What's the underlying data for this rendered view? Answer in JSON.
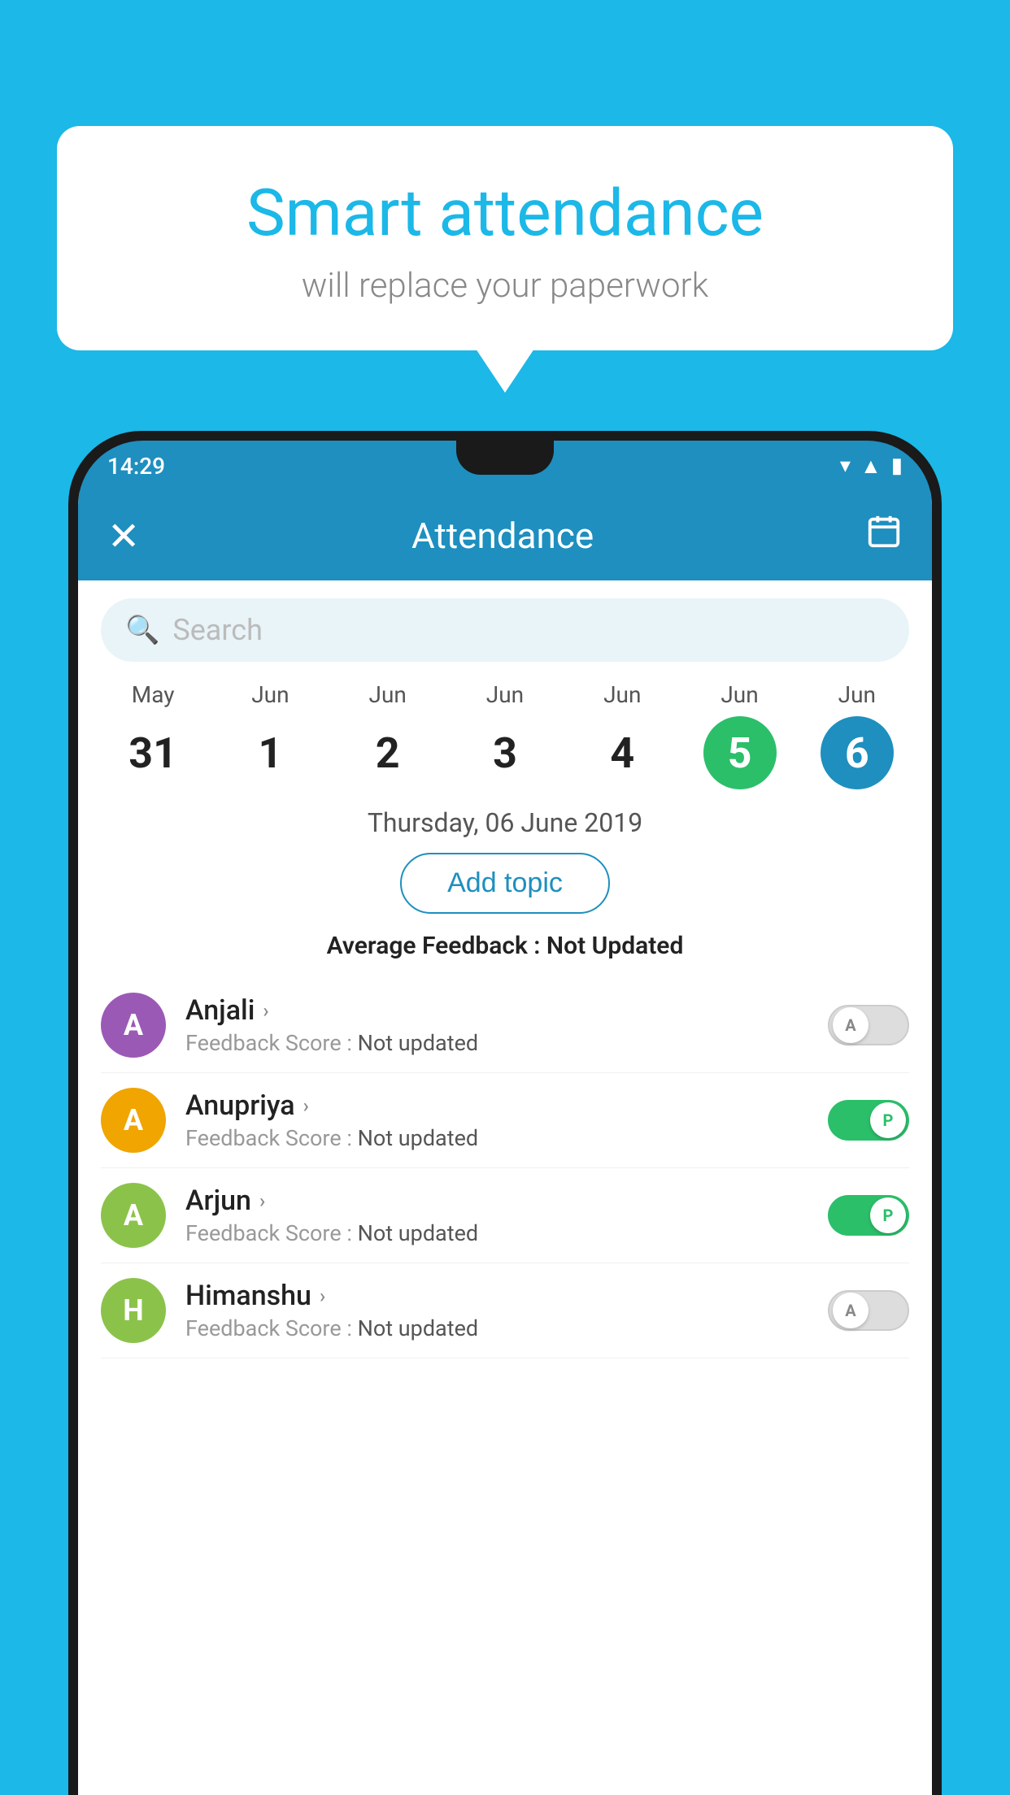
{
  "background": {
    "color": "#1BB8E8"
  },
  "speech_bubble": {
    "title": "Smart attendance",
    "subtitle": "will replace your paperwork"
  },
  "status_bar": {
    "time": "14:29",
    "wifi": "▼",
    "signal": "▲",
    "battery": "▮"
  },
  "app_bar": {
    "title": "Attendance",
    "close_label": "✕",
    "calendar_label": "📅"
  },
  "search": {
    "placeholder": "Search"
  },
  "calendar": {
    "days": [
      {
        "month": "May",
        "date": "31",
        "state": "normal"
      },
      {
        "month": "Jun",
        "date": "1",
        "state": "normal"
      },
      {
        "month": "Jun",
        "date": "2",
        "state": "normal"
      },
      {
        "month": "Jun",
        "date": "3",
        "state": "normal"
      },
      {
        "month": "Jun",
        "date": "4",
        "state": "normal"
      },
      {
        "month": "Jun",
        "date": "5",
        "state": "today"
      },
      {
        "month": "Jun",
        "date": "6",
        "state": "selected"
      }
    ]
  },
  "date_display": "Thursday, 06 June 2019",
  "add_topic_label": "Add topic",
  "average_feedback": {
    "label": "Average Feedback : ",
    "value": "Not Updated"
  },
  "students": [
    {
      "name": "Anjali",
      "feedback_label": "Feedback Score : ",
      "feedback_value": "Not updated",
      "avatar_letter": "A",
      "avatar_color": "#9B59B6",
      "toggle_state": "off",
      "toggle_letter": "A"
    },
    {
      "name": "Anupriya",
      "feedback_label": "Feedback Score : ",
      "feedback_value": "Not updated",
      "avatar_letter": "A",
      "avatar_color": "#F0A500",
      "toggle_state": "on",
      "toggle_letter": "P"
    },
    {
      "name": "Arjun",
      "feedback_label": "Feedback Score : ",
      "feedback_value": "Not updated",
      "avatar_letter": "A",
      "avatar_color": "#8BC34A",
      "toggle_state": "on",
      "toggle_letter": "P"
    },
    {
      "name": "Himanshu",
      "feedback_label": "Feedback Score : ",
      "feedback_value": "Not updated",
      "avatar_letter": "H",
      "avatar_color": "#8BC34A",
      "toggle_state": "off",
      "toggle_letter": "A"
    }
  ]
}
